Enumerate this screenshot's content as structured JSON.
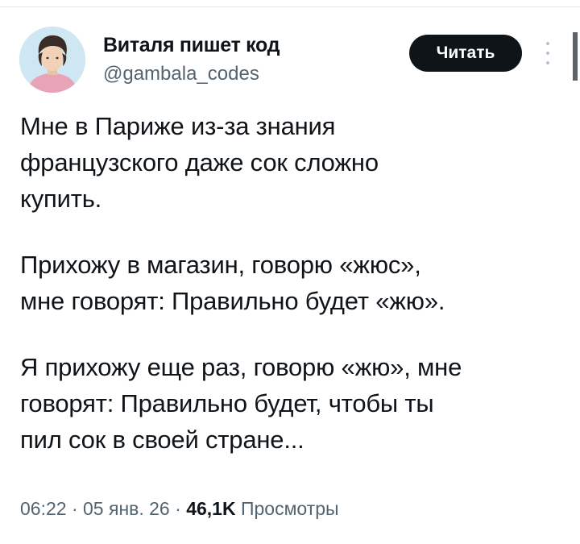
{
  "author": {
    "display_name": "Виталя пишет код",
    "handle": "@gambala_codes"
  },
  "actions": {
    "read_label": "Читать",
    "more_icon": "vertical-ellipsis-icon"
  },
  "tweet": {
    "paragraphs": [
      [
        "Мне в Париже из-за знания",
        "французского даже сок сложно",
        "купить."
      ],
      [
        "Прихожу в магазин, говорю «жюс»,",
        "мне говорят: Правильно будет «жю»."
      ],
      [
        "Я прихожу еще раз, говорю «жю», мне",
        "говорят: Правильно будет, чтобы ты",
        "пил сок в своей стране..."
      ]
    ]
  },
  "meta": {
    "time": "06:22",
    "separator": " · ",
    "date": "05 янв. 26",
    "views_count": "46,1K",
    "views_label": "Просмотры"
  },
  "colors": {
    "text": "#0f1419",
    "secondary": "#536471",
    "button_bg": "#0f1419"
  }
}
